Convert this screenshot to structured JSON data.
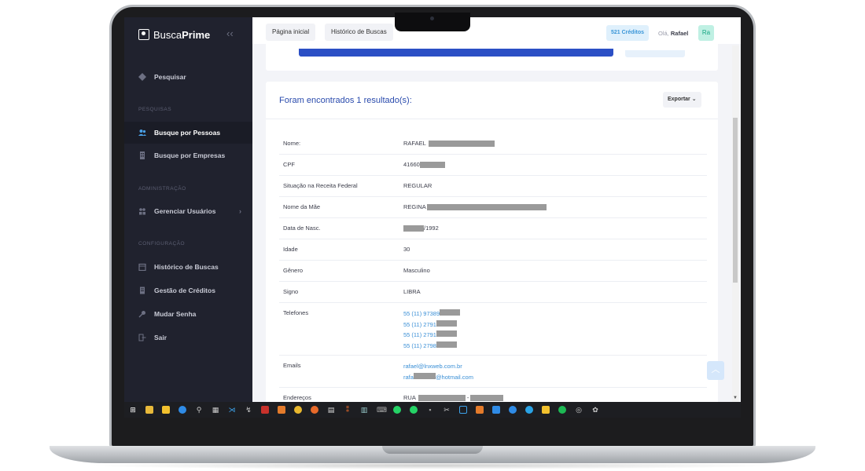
{
  "brand": {
    "name_light": "Busca",
    "name_bold": "Prime"
  },
  "sidebar": {
    "pesquisar": "Pesquisar",
    "section_pesquisas": "PESQUISAS",
    "busque_pessoas": "Busque por Pessoas",
    "busque_empresas": "Busque por Empresas",
    "section_admin": "ADMINISTRAÇÃO",
    "gerenciar_usuarios": "Gerenciar Usuários",
    "section_config": "CONFIGURAÇÃO",
    "historico": "Histórico de Buscas",
    "gestao_creditos": "Gestão de Créditos",
    "mudar_senha": "Mudar Senha",
    "sair": "Sair"
  },
  "topbar": {
    "tab_home": "Página inicial",
    "tab_history": "Histórico de Buscas",
    "credits": "521 Créditos",
    "greeting": "Olá,",
    "user": "Rafael",
    "avatar": "Ra"
  },
  "results": {
    "title": "Foram encontrados 1 resultado(s):",
    "export": "Exportar",
    "rows": [
      {
        "label": "Nome:",
        "value": "RAFAEL"
      },
      {
        "label": "CPF",
        "value": "41660"
      },
      {
        "label": "Situação na Receita Federal",
        "value": "REGULAR"
      },
      {
        "label": "Nome da Mãe",
        "value": "REGINA"
      },
      {
        "label": "Data de Nasc.",
        "value": "/1992"
      },
      {
        "label": "Idade",
        "value": "30"
      },
      {
        "label": "Gênero",
        "value": "Masculino"
      },
      {
        "label": "Signo",
        "value": "LIBRA"
      },
      {
        "label": "Telefones",
        "values": [
          "55 (11) 97389",
          "55 (11) 2791",
          "55 (11) 2791",
          "55 (11) 2798"
        ]
      },
      {
        "label": "Emails",
        "values": [
          "rafael@lnxweb.com.br",
          "rafa",
          "@hotmail.com"
        ]
      },
      {
        "label": "Endereços",
        "value": "RUA",
        "sep": "-"
      }
    ]
  },
  "colors": {
    "accent": "#2a4bad",
    "sidebar": "#20222e",
    "link": "#3a8fd6",
    "credits": "#3a96d8"
  }
}
